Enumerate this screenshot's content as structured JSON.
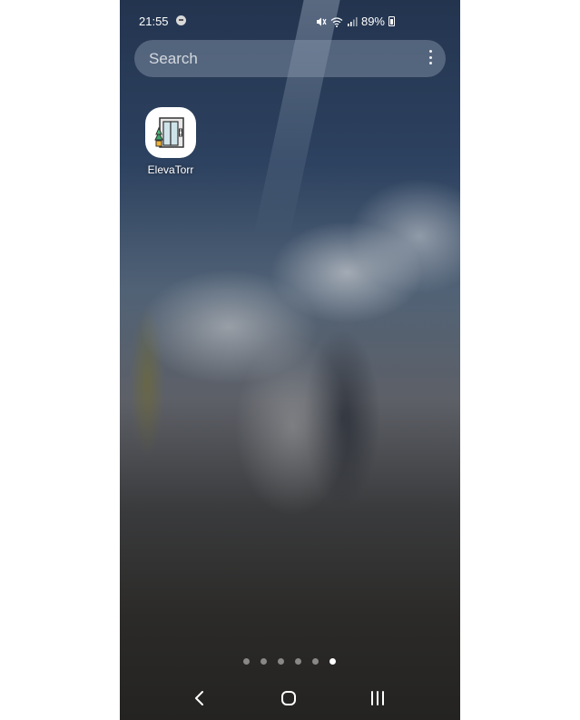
{
  "status_bar": {
    "time": "21:55",
    "battery": "89%",
    "icons": [
      "messages-notification-icon",
      "mute-icon",
      "wifi-icon",
      "signal-icon",
      "battery-charging-icon"
    ]
  },
  "search": {
    "placeholder": "Search",
    "menu_icon": "more-vertical-icon"
  },
  "apps": [
    {
      "label": "ElevaTorr",
      "icon": "elevator-icon"
    }
  ],
  "page_indicator": {
    "total": 6,
    "active_index": 5
  },
  "nav_bar": {
    "icons": [
      "back-icon",
      "home-icon",
      "recent-apps-icon"
    ]
  },
  "colors": {
    "text": "#ffffff",
    "search_bg": "#8c9baf"
  }
}
